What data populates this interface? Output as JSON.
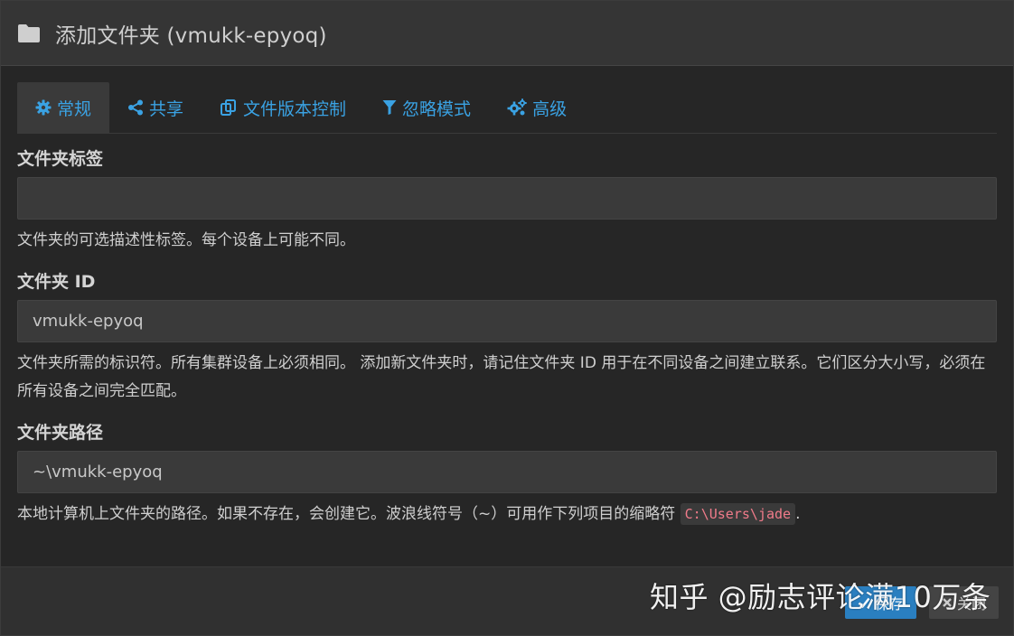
{
  "dialog": {
    "title": "添加文件夹 (vmukk-epyoq)",
    "title_icon": "folder-icon"
  },
  "tabs": [
    {
      "label": "常规",
      "icon": "gear-icon",
      "active": true
    },
    {
      "label": "共享",
      "icon": "share-icon",
      "active": false
    },
    {
      "label": "文件版本控制",
      "icon": "copy-icon",
      "active": false
    },
    {
      "label": "忽略模式",
      "icon": "filter-icon",
      "active": false
    },
    {
      "label": "高级",
      "icon": "cogs-icon",
      "active": false
    }
  ],
  "fields": {
    "label": {
      "title": "文件夹标签",
      "value": "",
      "help": "文件夹的可选描述性标签。每个设备上可能不同。"
    },
    "id": {
      "title": "文件夹 ID",
      "value": "vmukk-epyoq",
      "help": "文件夹所需的标识符。所有集群设备上必须相同。 添加新文件夹时，请记住文件夹 ID 用于在不同设备之间建立联系。它们区分大小写，必须在所有设备之间完全匹配。"
    },
    "path": {
      "title": "文件夹路径",
      "value": "~\\vmukk-epyoq",
      "help_prefix": "本地计算机上文件夹的路径。如果不存在，会创建它。波浪线符号（~）可用作下列项目的缩略符 ",
      "help_code": "C:\\Users\\jade",
      "help_suffix": "."
    }
  },
  "footer": {
    "save_label": "保存",
    "close_label": "关闭"
  },
  "watermark": "知乎 @励志评论满10万条",
  "colors": {
    "accent": "#3aa2e3",
    "save_button": "#2a7fc0",
    "background": "#262626",
    "code_text": "#f07b8a"
  }
}
